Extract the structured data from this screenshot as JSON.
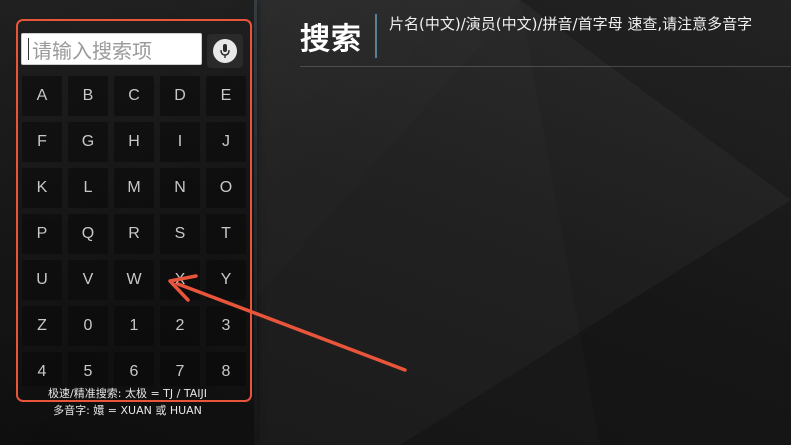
{
  "search": {
    "placeholder": "请输入搜索项"
  },
  "header": {
    "title": "搜索",
    "subtitle": "片名(中文)/演员(中文)/拼音/首字母 速查,请注意多音字"
  },
  "keyboard": {
    "keys": [
      "A",
      "B",
      "C",
      "D",
      "E",
      "F",
      "G",
      "H",
      "I",
      "J",
      "K",
      "L",
      "M",
      "N",
      "O",
      "P",
      "Q",
      "R",
      "S",
      "T",
      "U",
      "V",
      "W",
      "X",
      "Y",
      "Z",
      "0",
      "1",
      "2",
      "3",
      "4",
      "5",
      "6",
      "7",
      "8"
    ]
  },
  "hints": {
    "line1": "极速/精准搜索: 太极 = TJ / TAIJI",
    "line2": "多音字: 嬛 = XUAN 或 HUAN"
  },
  "icons": {
    "mic": "microphone-icon"
  },
  "colors": {
    "highlight_frame": "#e8553a",
    "arrow": "#e8553a",
    "divider": "#5b7f99"
  }
}
